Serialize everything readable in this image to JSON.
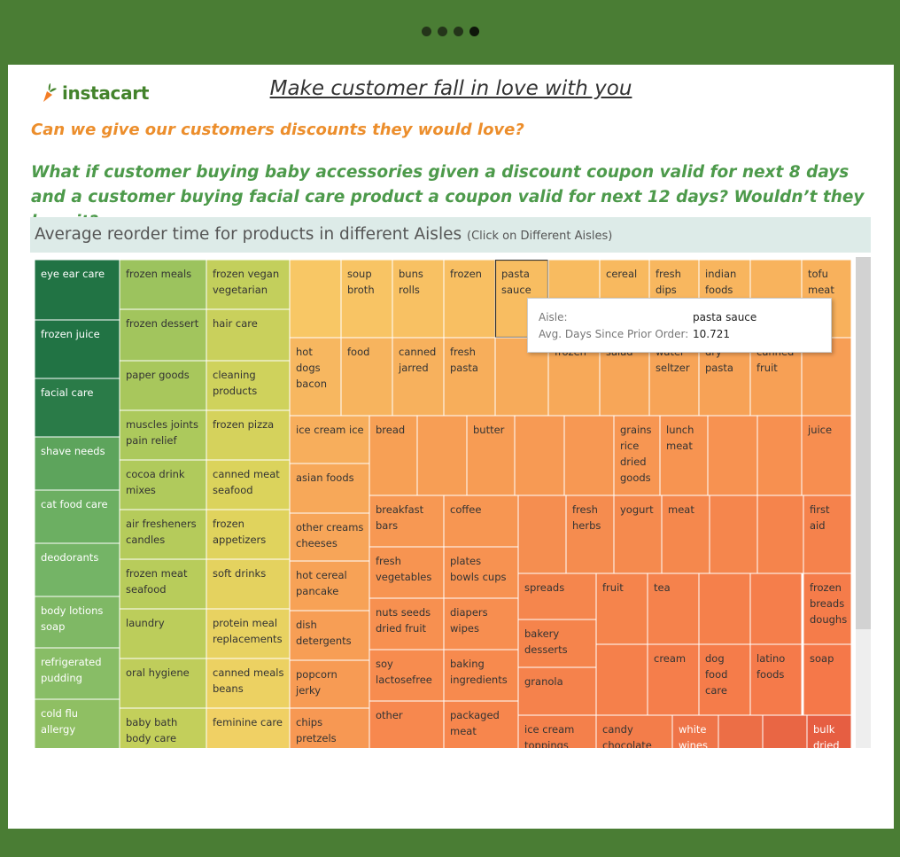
{
  "header": {
    "slides": 4,
    "active_slide": 4
  },
  "logo": {
    "text": "instacart"
  },
  "title": "Make customer fall in love with you",
  "question1": "Can we give our customers discounts they would love?",
  "question2": "What if  customer buying baby accessories given a discount coupon valid for next 8 days and a customer buying facial care product a coupon valid for next 12 days? Wouldn’t they love it?",
  "chart_header": {
    "title": "Average reorder time for products in different Aisles",
    "hint": "(Click on Different Aisles)"
  },
  "tooltip": {
    "aisle_label": "Aisle:",
    "aisle_value": "pasta sauce",
    "days_label": "Avg. Days Since Prior Order:",
    "days_value": "10.721"
  },
  "chart_data": {
    "type": "treemap",
    "title": "Average reorder time for products in different Aisles",
    "measure": "Avg. Days Since Prior Order",
    "color_scale": "green (shorter) to orange/red (longer)",
    "values_known": {
      "pasta sauce": 10.721
    },
    "aisles": [
      "eye ear care",
      "frozen juice",
      "facial care",
      "shave needs",
      "cat food care",
      "deodorants",
      "body lotions soap",
      "refrigerated pudding",
      "cold flu allergy",
      "frozen meals",
      "frozen dessert",
      "paper goods",
      "muscles joints pain relief",
      "cocoa drink mixes",
      "air fresheners candles",
      "frozen meat seafood",
      "laundry",
      "oral hygiene",
      "baby bath body care",
      "frozen vegan vegetarian",
      "hair care",
      "cleaning products",
      "frozen pizza",
      "canned meat seafood",
      "frozen appetizers",
      "soft drinks",
      "protein meal replacements",
      "canned meals beans",
      "feminine care",
      "soup broth",
      "buns rolls",
      "frozen",
      "pasta sauce",
      "cereal",
      "fresh dips",
      "indian foods",
      "tofu meat",
      "hot dogs bacon",
      "food",
      "canned jarred",
      "fresh pasta",
      "salad",
      "water seltzer",
      "dry pasta",
      "canned fruit",
      "ice cream ice",
      "bread",
      "butter",
      "grains rice dried goods",
      "lunch meat",
      "juice",
      "asian foods",
      "breakfast bars",
      "coffee",
      "fresh herbs",
      "yogurt",
      "meat",
      "first aid",
      "other creams cheeses",
      "fresh vegetables",
      "plates bowls cups",
      "spreads",
      "fruit",
      "tea",
      "frozen breads doughs",
      "hot cereal pancake",
      "nuts seeds dried fruit",
      "diapers wipes",
      "bakery desserts",
      "dish detergents",
      "soy lactosefree",
      "baking ingredients",
      "granola",
      "cream",
      "dog food care",
      "latino foods",
      "soap",
      "popcorn jerky",
      "other",
      "packaged meat",
      "chips pretzels",
      "ice cream toppings",
      "candy chocolate",
      "white wines",
      "bulk dried"
    ]
  },
  "treemap_cells": [
    {
      "label": "eye ear care",
      "color": "#217344",
      "text": "#ffffff"
    },
    {
      "label": "frozen juice",
      "color": "#217344",
      "text": "#ffffff"
    },
    {
      "label": "facial care",
      "color": "#2a7b48",
      "text": "#ffffff"
    },
    {
      "label": "shave needs",
      "color": "#5da45c",
      "text": "#ffffff"
    },
    {
      "label": "cat food care",
      "color": "#6caf62",
      "text": "#ffffff"
    },
    {
      "label": "deodorants",
      "color": "#74b466",
      "text": "#ffffff"
    },
    {
      "label": "body lotions\nsoap",
      "color": "#7fb865",
      "text": "#ffffff"
    },
    {
      "label": "refrigerated\npudding",
      "color": "#88bd66",
      "text": "#ffffff"
    },
    {
      "label": "cold flu\nallergy",
      "color": "#8fbf63",
      "text": "#ffffff"
    },
    {
      "label": "frozen meals",
      "color": "#9cc35e",
      "text": "#333333"
    },
    {
      "label": "frozen dessert",
      "color": "#a2c55d",
      "text": "#333333"
    },
    {
      "label": "paper goods",
      "color": "#a8c75c",
      "text": "#333333"
    },
    {
      "label": "muscles joints\npain relief",
      "color": "#acc95c",
      "text": "#333333"
    },
    {
      "label": "cocoa drink\nmixes",
      "color": "#b0ca5c",
      "text": "#333333"
    },
    {
      "label": "air fresheners\ncandles",
      "color": "#b5cb5b",
      "text": "#333333"
    },
    {
      "label": "frozen meat\nseafood",
      "color": "#b8cc5b",
      "text": "#333333"
    },
    {
      "label": "laundry",
      "color": "#bccd5b",
      "text": "#333333"
    },
    {
      "label": "oral hygiene",
      "color": "#bfcd5b",
      "text": "#333333"
    },
    {
      "label": "baby bath\nbody care",
      "color": "#c3cf5b",
      "text": "#333333"
    },
    {
      "label": "frozen vegan\nvegetarian",
      "color": "#c3cf5c",
      "text": "#333333"
    },
    {
      "label": "hair care",
      "color": "#c9d05c",
      "text": "#333333"
    },
    {
      "label": "cleaning\nproducts",
      "color": "#cfd25c",
      "text": "#333333"
    },
    {
      "label": "frozen pizza",
      "color": "#d5d25c",
      "text": "#333333"
    },
    {
      "label": "canned meat\nseafood",
      "color": "#dbd35c",
      "text": "#333333"
    },
    {
      "label": "frozen\nappetizers",
      "color": "#e0d35d",
      "text": "#333333"
    },
    {
      "label": "soft drinks",
      "color": "#e4d25f",
      "text": "#333333"
    },
    {
      "label": "protein meal\nreplacements",
      "color": "#e8d261",
      "text": "#333333"
    },
    {
      "label": "canned meals\nbeans",
      "color": "#ecd162",
      "text": "#333333"
    },
    {
      "label": "feminine care",
      "color": "#f0d064",
      "text": "#333333"
    },
    {
      "label": "",
      "color": "#f8c765",
      "text": "#333333"
    },
    {
      "label": "soup\nbroth",
      "color": "#f8c464",
      "text": "#333333"
    },
    {
      "label": "buns\nrolls",
      "color": "#f8c163",
      "text": "#333333"
    },
    {
      "label": "frozen",
      "color": "#f8bf62",
      "text": "#333333"
    },
    {
      "label": "pasta\nsauce",
      "color": "#f8bd61",
      "text": "#333333"
    },
    {
      "label": "",
      "color": "#f8bb60",
      "text": "#333333"
    },
    {
      "label": "cereal",
      "color": "#f8b95f",
      "text": "#333333"
    },
    {
      "label": "fresh\ndips",
      "color": "#f8b75f",
      "text": "#333333"
    },
    {
      "label": "indian\nfoods",
      "color": "#f8b55e",
      "text": "#333333"
    },
    {
      "label": "",
      "color": "#f8b35d",
      "text": "#333333"
    },
    {
      "label": "tofu\nmeat",
      "color": "#f8b15c",
      "text": "#333333"
    },
    {
      "label": "hot\ndogs\nbacon",
      "color": "#f7b760",
      "text": "#333333"
    },
    {
      "label": "food",
      "color": "#f7b45e",
      "text": "#333333"
    },
    {
      "label": "canned\njarred",
      "color": "#f7b15d",
      "text": "#333333"
    },
    {
      "label": "fresh\npasta",
      "color": "#f7ae5b",
      "text": "#333333"
    },
    {
      "label": "",
      "color": "#f7ab5a",
      "text": "#333333"
    },
    {
      "label": "frozen",
      "color": "#f7a959",
      "text": "#333333"
    },
    {
      "label": "salad",
      "color": "#f7a658",
      "text": "#333333"
    },
    {
      "label": "water\nseltzer",
      "color": "#f7a457",
      "text": "#333333"
    },
    {
      "label": "dry\npasta",
      "color": "#f7a256",
      "text": "#333333"
    },
    {
      "label": "canned\nfruit",
      "color": "#f7a055",
      "text": "#333333"
    },
    {
      "label": "",
      "color": "#f79e55",
      "text": "#333333"
    },
    {
      "label": "ice cream ice",
      "color": "#f7ae5c",
      "text": "#333333"
    },
    {
      "label": "asian foods",
      "color": "#f7a859",
      "text": "#333333"
    },
    {
      "label": "other creams\ncheeses",
      "color": "#f7a558",
      "text": "#333333"
    },
    {
      "label": "hot cereal\npancake",
      "color": "#f7a256",
      "text": "#333333"
    },
    {
      "label": "dish\ndetergents",
      "color": "#f79e55",
      "text": "#333333"
    },
    {
      "label": "popcorn\njerky",
      "color": "#f79b54",
      "text": "#333333"
    },
    {
      "label": "chips\npretzels",
      "color": "#f79853",
      "text": "#333333"
    },
    {
      "label": "bread",
      "color": "#f7a055",
      "text": "#333333"
    },
    {
      "label": "",
      "color": "#f79e55",
      "text": "#333333"
    },
    {
      "label": "butter",
      "color": "#f79c54",
      "text": "#333333"
    },
    {
      "label": "",
      "color": "#f79a54",
      "text": "#333333"
    },
    {
      "label": "",
      "color": "#f79853",
      "text": "#333333"
    },
    {
      "label": "grains\nrice\ndried\ngoods",
      "color": "#f79652",
      "text": "#333333"
    },
    {
      "label": "lunch\nmeat",
      "color": "#f79451",
      "text": "#333333"
    },
    {
      "label": "",
      "color": "#f79251",
      "text": "#333333"
    },
    {
      "label": "",
      "color": "#f79050",
      "text": "#333333"
    },
    {
      "label": "juice",
      "color": "#f78e50",
      "text": "#333333"
    },
    {
      "label": "breakfast\nbars",
      "color": "#f79853",
      "text": "#333333"
    },
    {
      "label": "coffee",
      "color": "#f79652",
      "text": "#333333"
    },
    {
      "label": "fresh\nvegetables",
      "color": "#f79451",
      "text": "#333333"
    },
    {
      "label": "plates\nbowls cups",
      "color": "#f79251",
      "text": "#333333"
    },
    {
      "label": "nuts seeds\ndried fruit",
      "color": "#f79050",
      "text": "#333333"
    },
    {
      "label": "diapers\nwipes",
      "color": "#f78e50",
      "text": "#333333"
    },
    {
      "label": "soy\nlactosefree",
      "color": "#f78c4f",
      "text": "#333333"
    },
    {
      "label": "baking\ningredients",
      "color": "#f78a4e",
      "text": "#333333"
    },
    {
      "label": "other",
      "color": "#f7884e",
      "text": "#333333"
    },
    {
      "label": "packaged\nmeat",
      "color": "#f7864d",
      "text": "#333333"
    },
    {
      "label": "",
      "color": "#f58e50",
      "text": "#333333"
    },
    {
      "label": "fresh\nherbs",
      "color": "#f58c4f",
      "text": "#333333"
    },
    {
      "label": "yogurt",
      "color": "#f58a4e",
      "text": "#333333"
    },
    {
      "label": "meat",
      "color": "#f5884d",
      "text": "#333333"
    },
    {
      "label": "",
      "color": "#f5864d",
      "text": "#333333"
    },
    {
      "label": "",
      "color": "#f5844c",
      "text": "#333333"
    },
    {
      "label": "first\naid",
      "color": "#f5824c",
      "text": "#333333"
    },
    {
      "label": "spreads",
      "color": "#f5864d",
      "text": "#333333"
    },
    {
      "label": "fruit",
      "color": "#f5844c",
      "text": "#333333"
    },
    {
      "label": "tea",
      "color": "#f5824c",
      "text": "#333333"
    },
    {
      "label": "",
      "color": "#f5804b",
      "text": "#333333"
    },
    {
      "label": "",
      "color": "#f57e4b",
      "text": "#333333"
    },
    {
      "label": "frozen\nbreads\ndoughs",
      "color": "#f57c4a",
      "text": "#333333"
    },
    {
      "label": "bakery\ndesserts",
      "color": "#f5844c",
      "text": "#333333"
    },
    {
      "label": "granola",
      "color": "#f5824c",
      "text": "#333333"
    },
    {
      "label": "",
      "color": "#f5804b",
      "text": "#333333"
    },
    {
      "label": "cream",
      "color": "#f57e4b",
      "text": "#333333"
    },
    {
      "label": "dog\nfood\ncare",
      "color": "#f57c4a",
      "text": "#333333"
    },
    {
      "label": "latino\nfoods",
      "color": "#f57a4a",
      "text": "#333333"
    },
    {
      "label": "soap",
      "color": "#f57849",
      "text": "#333333"
    },
    {
      "label": "ice cream\ntoppings",
      "color": "#f4804b",
      "text": "#333333"
    },
    {
      "label": "candy\nchocolate",
      "color": "#f37d4a",
      "text": "#333333"
    },
    {
      "label": "white\nwines",
      "color": "#ef7448",
      "text": "#ffffff"
    },
    {
      "label": "",
      "color": "#ec6e46",
      "text": "#333333"
    },
    {
      "label": "",
      "color": "#e96644",
      "text": "#333333"
    },
    {
      "label": "bulk\ndried",
      "color": "#e65e42",
      "text": "#ffffff"
    }
  ]
}
